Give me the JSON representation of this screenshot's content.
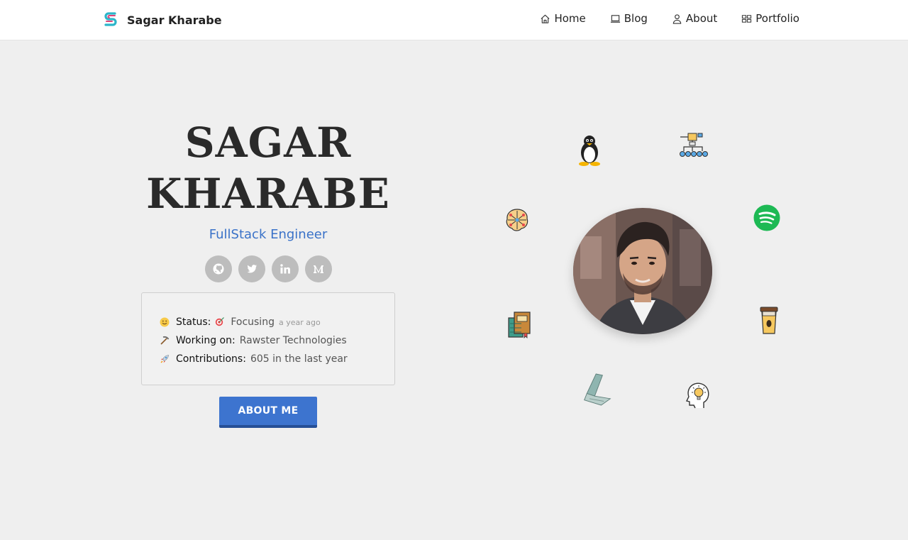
{
  "header": {
    "brand_name": "Sagar Kharabe",
    "nav": [
      {
        "label": "Home",
        "icon": "home-icon"
      },
      {
        "label": "Blog",
        "icon": "laptop-icon"
      },
      {
        "label": "About",
        "icon": "user-icon"
      },
      {
        "label": "Portfolio",
        "icon": "grid-icon"
      }
    ]
  },
  "hero": {
    "name_line1": "SAGAR",
    "name_line2": "KHARABE",
    "role": "FullStack Engineer",
    "socials": [
      "github-icon",
      "twitter-icon",
      "linkedin-icon",
      "medium-icon"
    ]
  },
  "status": {
    "status_label": "Status:",
    "status_value": "Focusing",
    "status_time": "a year ago",
    "working_label": "Working on:",
    "working_value": "Rawster Technologies",
    "contrib_label": "Contributions:",
    "contrib_value": "605 in the last year"
  },
  "cta": {
    "about_label": "ABOUT ME"
  },
  "orbit_icons": [
    "linux-penguin-icon",
    "network-hierarchy-icon",
    "brain-network-icon",
    "spotify-icon",
    "books-icon",
    "coffee-cup-icon",
    "laptop-icon",
    "idea-head-icon"
  ],
  "colors": {
    "accent": "#3d74cf",
    "role": "#3a72c8",
    "spotify": "#1db954"
  }
}
